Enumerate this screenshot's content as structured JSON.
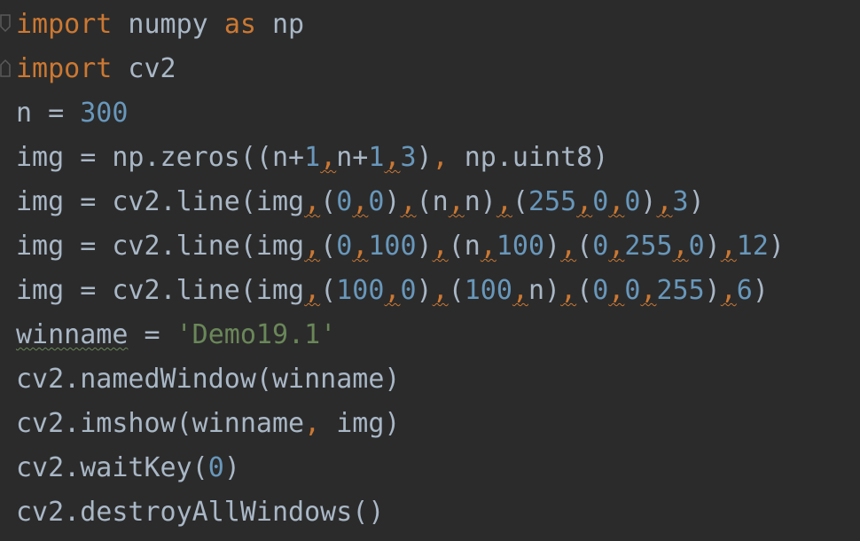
{
  "editor": {
    "lines": [
      [
        {
          "t": "import",
          "c": "kw"
        },
        {
          "t": " numpy "
        },
        {
          "t": "as",
          "c": "kw"
        },
        {
          "t": " np"
        }
      ],
      [
        {
          "t": "import",
          "c": "kw"
        },
        {
          "t": " cv2"
        }
      ],
      [
        {
          "t": "n = "
        },
        {
          "t": "300",
          "c": "num"
        }
      ],
      [
        {
          "t": "img = np.zeros((n+"
        },
        {
          "t": "1",
          "c": "num"
        },
        {
          "t": ",",
          "c": "comma warn"
        },
        {
          "t": "n+"
        },
        {
          "t": "1",
          "c": "num"
        },
        {
          "t": ",",
          "c": "comma warn"
        },
        {
          "t": "3",
          "c": "num"
        },
        {
          "t": ")"
        },
        {
          "t": ",",
          "c": "comma"
        },
        {
          "t": " np.uint8)"
        }
      ],
      [
        {
          "t": "img = cv2.line(img"
        },
        {
          "t": ",",
          "c": "comma warn"
        },
        {
          "t": "("
        },
        {
          "t": "0",
          "c": "num"
        },
        {
          "t": ",",
          "c": "comma warn"
        },
        {
          "t": "0",
          "c": "num"
        },
        {
          "t": ")"
        },
        {
          "t": ",",
          "c": "comma warn"
        },
        {
          "t": "(n"
        },
        {
          "t": ",",
          "c": "comma warn"
        },
        {
          "t": "n)"
        },
        {
          "t": ",",
          "c": "comma warn"
        },
        {
          "t": "("
        },
        {
          "t": "255",
          "c": "num"
        },
        {
          "t": ",",
          "c": "comma warn"
        },
        {
          "t": "0",
          "c": "num"
        },
        {
          "t": ",",
          "c": "comma warn"
        },
        {
          "t": "0",
          "c": "num"
        },
        {
          "t": ")"
        },
        {
          "t": ",",
          "c": "comma warn"
        },
        {
          "t": "3",
          "c": "num"
        },
        {
          "t": ")"
        }
      ],
      [
        {
          "t": "img = cv2.line(img"
        },
        {
          "t": ",",
          "c": "comma warn"
        },
        {
          "t": "("
        },
        {
          "t": "0",
          "c": "num"
        },
        {
          "t": ",",
          "c": "comma warn"
        },
        {
          "t": "100",
          "c": "num"
        },
        {
          "t": ")"
        },
        {
          "t": ",",
          "c": "comma warn"
        },
        {
          "t": "(n"
        },
        {
          "t": ",",
          "c": "comma warn"
        },
        {
          "t": "100",
          "c": "num"
        },
        {
          "t": ")"
        },
        {
          "t": ",",
          "c": "comma warn"
        },
        {
          "t": "("
        },
        {
          "t": "0",
          "c": "num"
        },
        {
          "t": ",",
          "c": "comma warn"
        },
        {
          "t": "255",
          "c": "num"
        },
        {
          "t": ",",
          "c": "comma warn"
        },
        {
          "t": "0",
          "c": "num"
        },
        {
          "t": ")"
        },
        {
          "t": ",",
          "c": "comma warn"
        },
        {
          "t": "12",
          "c": "num"
        },
        {
          "t": ")"
        }
      ],
      [
        {
          "t": "img = cv2.line(img"
        },
        {
          "t": ",",
          "c": "comma warn"
        },
        {
          "t": "("
        },
        {
          "t": "100",
          "c": "num"
        },
        {
          "t": ",",
          "c": "comma warn"
        },
        {
          "t": "0",
          "c": "num"
        },
        {
          "t": ")"
        },
        {
          "t": ",",
          "c": "comma warn"
        },
        {
          "t": "("
        },
        {
          "t": "100",
          "c": "num"
        },
        {
          "t": ",",
          "c": "comma warn"
        },
        {
          "t": "n)"
        },
        {
          "t": ",",
          "c": "comma warn"
        },
        {
          "t": "("
        },
        {
          "t": "0",
          "c": "num"
        },
        {
          "t": ",",
          "c": "comma warn"
        },
        {
          "t": "0",
          "c": "num"
        },
        {
          "t": ",",
          "c": "comma warn"
        },
        {
          "t": "255",
          "c": "num"
        },
        {
          "t": ")"
        },
        {
          "t": ",",
          "c": "comma warn"
        },
        {
          "t": "6",
          "c": "num"
        },
        {
          "t": ")"
        }
      ],
      [
        {
          "t": "winname",
          "c": "typo"
        },
        {
          "t": " = "
        },
        {
          "t": "'Demo19.1'",
          "c": "str"
        }
      ],
      [
        {
          "t": "cv2.namedWindow(winname)"
        }
      ],
      [
        {
          "t": "cv2.imshow(winname"
        },
        {
          "t": ",",
          "c": "comma"
        },
        {
          "t": " img)"
        }
      ],
      [
        {
          "t": "cv2.waitKey("
        },
        {
          "t": "0",
          "c": "num"
        },
        {
          "t": ")"
        }
      ],
      [
        {
          "t": "cv2.destroyAllWindows()"
        }
      ]
    ],
    "colors": {
      "background": "#2b2b2b",
      "default_text": "#a9b7c6",
      "keyword": "#cc7832",
      "number": "#6897bb",
      "string": "#6a8759"
    }
  }
}
